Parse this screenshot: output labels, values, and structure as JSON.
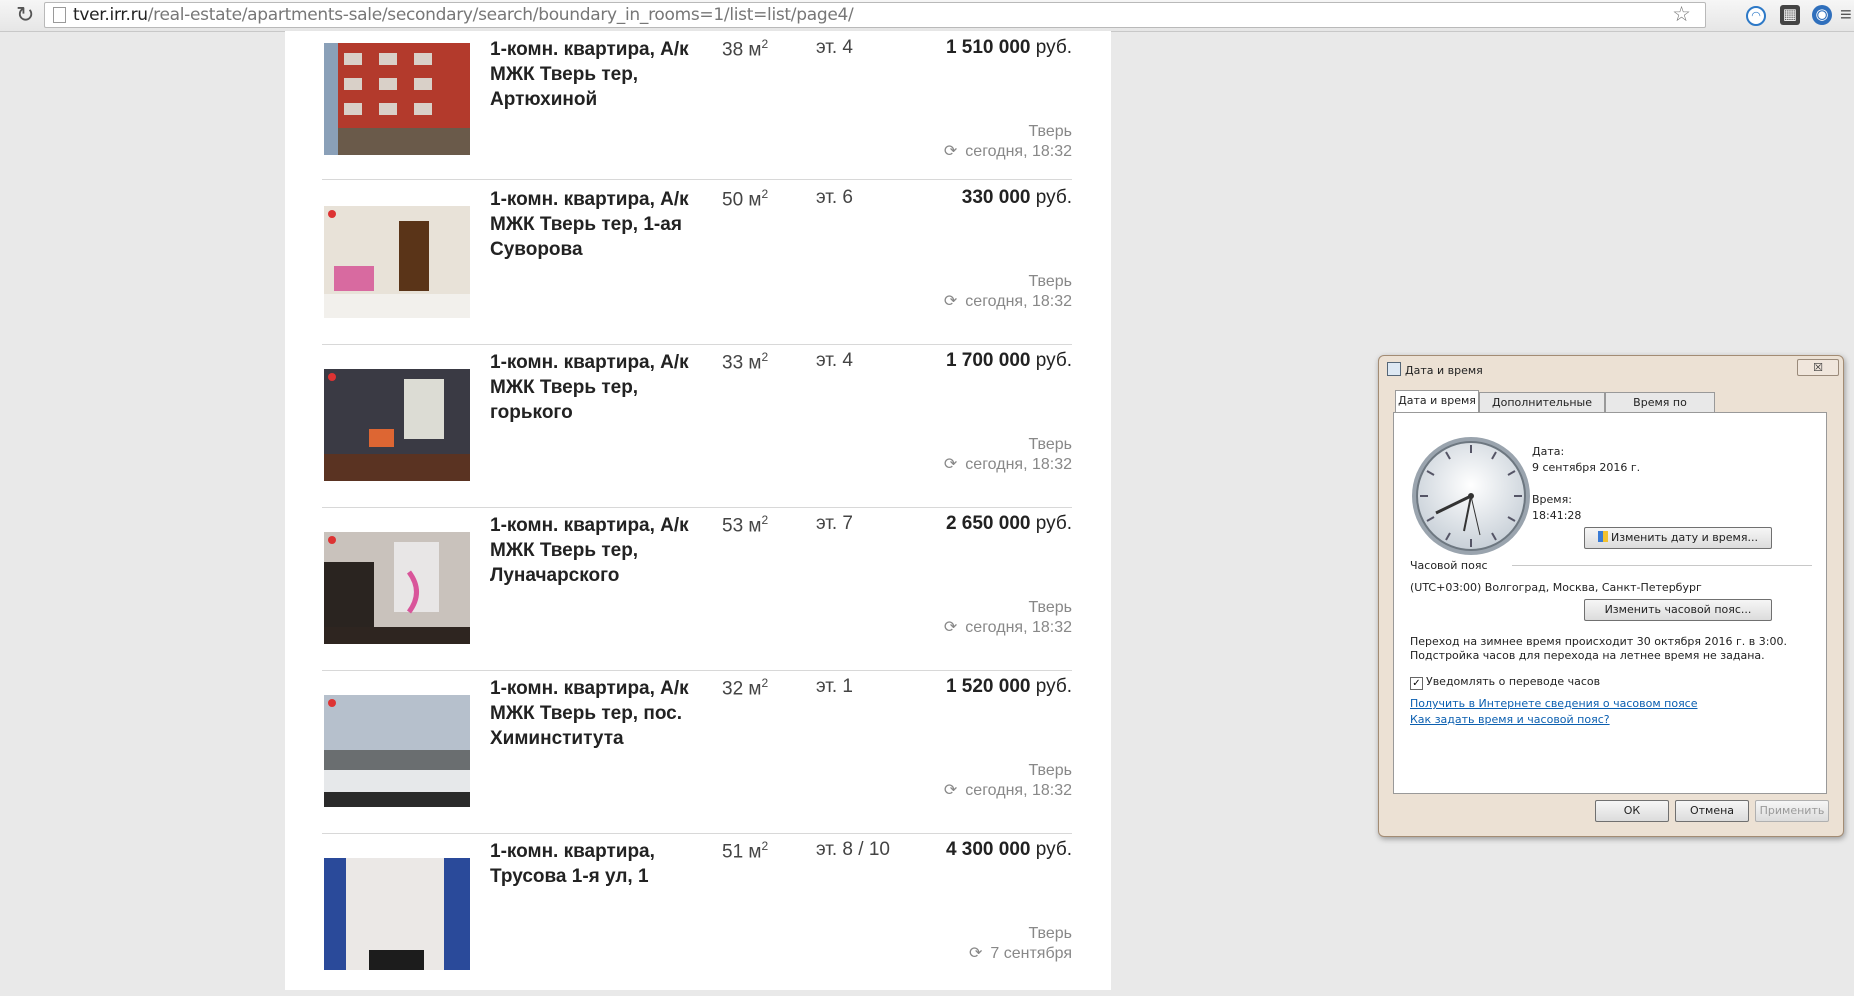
{
  "browser": {
    "url_domain": "tver.irr.ru",
    "url_path": "/real-estate/apartments-sale/secondary/search/boundary_in_rooms=1/list=list/page4/"
  },
  "listings": [
    {
      "title": "1-комн. квартира, А/к МЖК Тверь тер, Артюхиной",
      "area": "38 м",
      "area_sup": "2",
      "floor": "эт. 4",
      "price": "1 510 000",
      "currency": "руб.",
      "city": "Тверь",
      "date": "сегодня, 18:32"
    },
    {
      "title": "1-комн. квартира, А/к МЖК Тверь тер, 1-ая Суворова",
      "area": "50 м",
      "area_sup": "2",
      "floor": "эт. 6",
      "price": "330 000",
      "currency": "руб.",
      "city": "Тверь",
      "date": "сегодня, 18:32"
    },
    {
      "title": "1-комн. квартира, А/к МЖК Тверь тер, горького",
      "area": "33 м",
      "area_sup": "2",
      "floor": "эт. 4",
      "price": "1 700 000",
      "currency": "руб.",
      "city": "Тверь",
      "date": "сегодня, 18:32"
    },
    {
      "title": "1-комн. квартира, А/к МЖК Тверь тер, Луначарского",
      "area": "53 м",
      "area_sup": "2",
      "floor": "эт. 7",
      "price": "2 650 000",
      "currency": "руб.",
      "city": "Тверь",
      "date": "сегодня, 18:32"
    },
    {
      "title": "1-комн. квартира, А/к МЖК Тверь тер, пос. Химинститута",
      "area": "32 м",
      "area_sup": "2",
      "floor": "эт. 1",
      "price": "1 520 000",
      "currency": "руб.",
      "city": "Тверь",
      "date": "сегодня, 18:32"
    },
    {
      "title": "1-комн. квартира, Трусова 1-я ул, 1",
      "area": "51 м",
      "area_sup": "2",
      "floor": "эт. 8 / 10",
      "price": "4 300 000",
      "currency": "руб.",
      "city": "Тверь",
      "date": "7 сентября"
    }
  ],
  "dialog": {
    "title": "Дата и время",
    "close": "☒",
    "tabs": [
      "Дата и время",
      "Дополнительные часы",
      "Время по Интернету"
    ],
    "date_label": "Дата:",
    "date_value": "9 сентября 2016 г.",
    "time_label": "Время:",
    "time_value": "18:41:28",
    "change_datetime_button": "Изменить дату и время...",
    "timezone_label": "Часовой пояс",
    "timezone_value": "(UTC+03:00) Волгоград, Москва, Санкт-Петербург",
    "change_timezone_button": "Изменить часовой пояс...",
    "dst_line1": "Переход на зимнее время происходит 30 октября 2016 г. в 3:00.",
    "dst_line2": "Подстройка часов для перехода на летнее время не задана.",
    "notify_checkbox": "Уведомлять о переводе часов",
    "link1": "Получить в Интернете сведения о часовом поясе",
    "link2": "Как задать время и часовой пояс?",
    "ok": "ОК",
    "cancel": "Отмена",
    "apply": "Применить"
  }
}
